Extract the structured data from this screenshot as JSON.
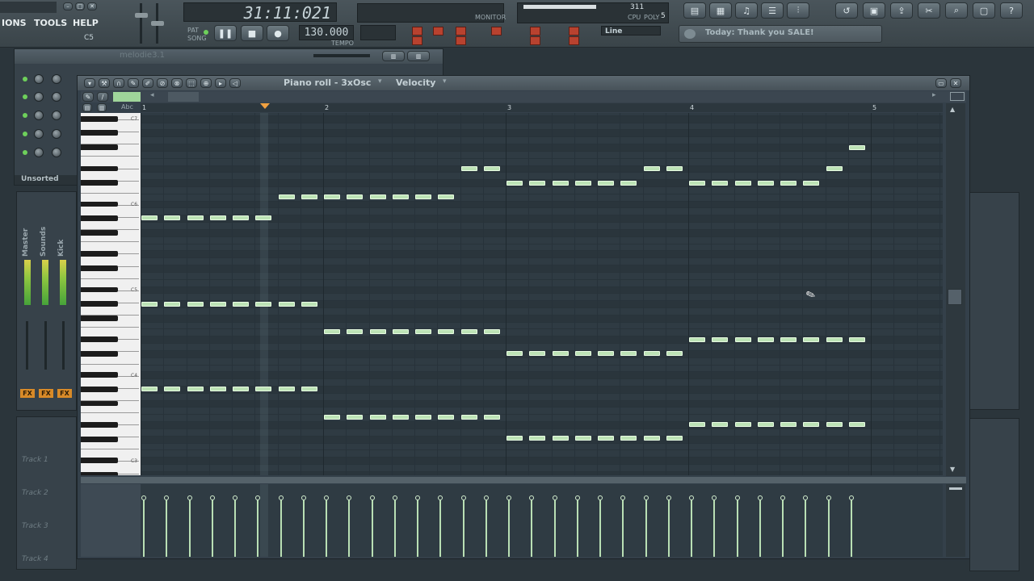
{
  "menu": {
    "items": [
      "IONS",
      "TOOLS",
      "HELP"
    ]
  },
  "transport": {
    "time": "31:11:021",
    "tempo": "130.000",
    "tempo_label": "TEMPO",
    "pattern": "5",
    "cpu_poly": "311",
    "cpu_label": "CPU",
    "poly_label": "POLY",
    "monitor": "MONITOR",
    "snap_mode": "Line",
    "song_label": "SONG",
    "pat_label": "PAT",
    "current_note": "C5"
  },
  "hint_bar": {
    "text": "Today: Thank you SALE!"
  },
  "channel_rack": {
    "title": "melodie3.1",
    "filter": "Unsorted"
  },
  "mixer": {
    "labels": [
      "Master",
      "Sounds",
      "Kick"
    ],
    "fx": [
      "FX",
      "FX",
      "FX"
    ]
  },
  "playlist": {
    "tracks": [
      "Track 1",
      "Track 2",
      "Track 3",
      "Track 4"
    ]
  },
  "piano_roll": {
    "title": "Piano roll - 3xOsc",
    "target": "Velocity",
    "bars": [
      "1",
      "2",
      "3",
      "4",
      "5"
    ],
    "octave_labels": [
      "C7",
      "C6",
      "C5",
      "C4",
      "C3"
    ]
  },
  "colors": {
    "note": "#bde3b6",
    "grid_bg": "#2f3b43",
    "highlight_key": "#e7733a"
  },
  "icons": [
    "pause-icon",
    "stop-icon",
    "record-icon",
    "close-icon",
    "arrow-left-icon",
    "arrow-right-icon"
  ]
}
